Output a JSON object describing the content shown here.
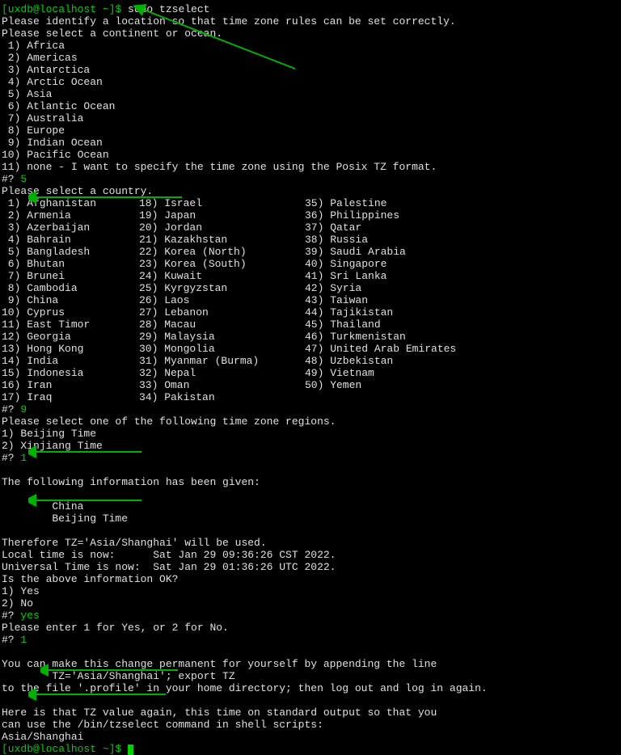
{
  "prompt1": "[uxdb@localhost ~]$ ",
  "cmd1": "sudo tzselect",
  "intro1": "Please identify a location so that time zone rules can be set correctly.",
  "intro2": "Please select a continent or ocean.",
  "continents": [
    " 1) Africa",
    " 2) Americas",
    " 3) Antarctica",
    " 4) Arctic Ocean",
    " 5) Asia",
    " 6) Atlantic Ocean",
    " 7) Australia",
    " 8) Europe",
    " 9) Indian Ocean",
    "10) Pacific Ocean",
    "11) none - I want to specify the time zone using the Posix TZ format."
  ],
  "q1": "#? ",
  "a1": "5",
  "country_prompt": "Please select a country.",
  "countries_col1": [
    " 1) Afghanistan",
    " 2) Armenia",
    " 3) Azerbaijan",
    " 4) Bahrain",
    " 5) Bangladesh",
    " 6) Bhutan",
    " 7) Brunei",
    " 8) Cambodia",
    " 9) China",
    "10) Cyprus",
    "11) East Timor",
    "12) Georgia",
    "13) Hong Kong",
    "14) India",
    "15) Indonesia",
    "16) Iran",
    "17) Iraq"
  ],
  "countries_col2": [
    "18) Israel",
    "19) Japan",
    "20) Jordan",
    "21) Kazakhstan",
    "22) Korea (North)",
    "23) Korea (South)",
    "24) Kuwait",
    "25) Kyrgyzstan",
    "26) Laos",
    "27) Lebanon",
    "28) Macau",
    "29) Malaysia",
    "30) Mongolia",
    "31) Myanmar (Burma)",
    "32) Nepal",
    "33) Oman",
    "34) Pakistan"
  ],
  "countries_col3": [
    "35) Palestine",
    "36) Philippines",
    "37) Qatar",
    "38) Russia",
    "39) Saudi Arabia",
    "40) Singapore",
    "41) Sri Lanka",
    "42) Syria",
    "43) Taiwan",
    "44) Tajikistan",
    "45) Thailand",
    "46) Turkmenistan",
    "47) United Arab Emirates",
    "48) Uzbekistan",
    "49) Vietnam",
    "50) Yemen"
  ],
  "q2": "#? ",
  "a2": "9",
  "region_prompt": "Please select one of the following time zone regions.",
  "regions": [
    "1) Beijing Time",
    "2) Xinjiang Time"
  ],
  "q3": "#? ",
  "a3": "1",
  "summary1": "The following information has been given:",
  "summary_country": "        China",
  "summary_region": "        Beijing Time",
  "tz_line": "Therefore TZ='Asia/Shanghai' will be used.",
  "local_time": "Local time is now:      Sat Jan 29 09:36:26 CST 2022.",
  "utc_time": "Universal Time is now:  Sat Jan 29 01:36:26 UTC 2022.",
  "ok_prompt": "Is the above information OK?",
  "ok_opts": [
    "1) Yes",
    "2) No"
  ],
  "q4": "#? ",
  "a4": "yes",
  "retry": "Please enter 1 for Yes, or 2 for No.",
  "q5": "#? ",
  "a5": "1",
  "perm1": "You can make this change permanent for yourself by appending the line",
  "perm2": "        TZ='Asia/Shanghai'; export TZ",
  "perm3": "to the file '.profile' in your home directory; then log out and log in again.",
  "out1": "Here is that TZ value again, this time on standard output so that you",
  "out2": "can use the /bin/tzselect command in shell scripts:",
  "tz_out": "Asia/Shanghai",
  "prompt2": "[uxdb@localhost ~]$ "
}
